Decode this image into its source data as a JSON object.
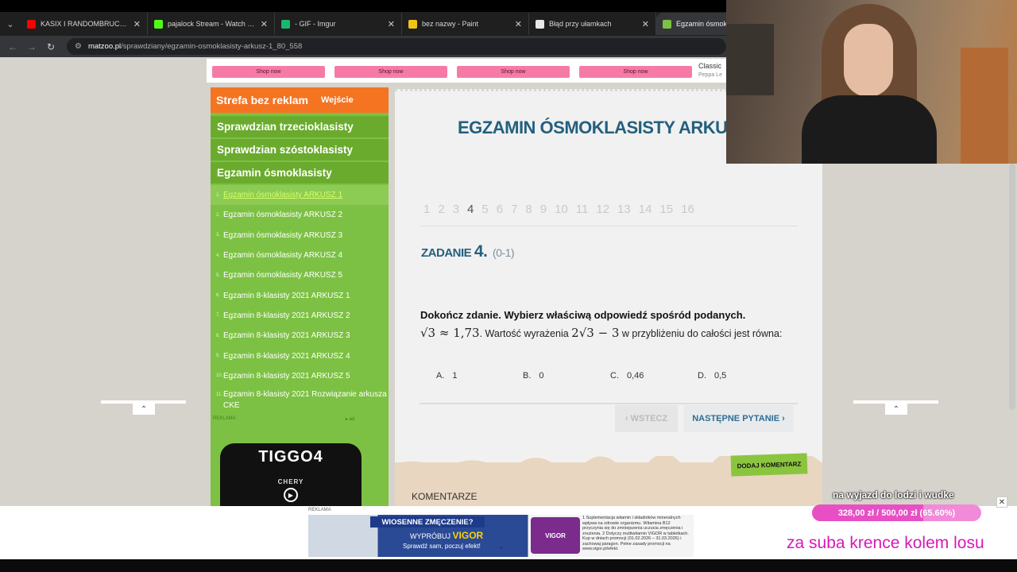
{
  "browser": {
    "tabs": [
      {
        "title": "KASIX I RANDOMBRUCE WYJAŚ",
        "color": "#ff0000"
      },
      {
        "title": "pajalock Stream - Watch Live o",
        "color": "#53fc18"
      },
      {
        "title": "- GIF - Imgur",
        "color": "#1bb76e"
      },
      {
        "title": "bez nazwy - Paint",
        "color": "#f0c419"
      },
      {
        "title": "Błąd przy ułamkach",
        "color": "#e8e8e8"
      },
      {
        "title": "Egzamin ósmoklasi",
        "color": "#7cc143"
      }
    ],
    "url_host": "matzoo.pl",
    "url_path": "/sprawdziany/egzamin-osmoklasisty-arkusz-1_80_558"
  },
  "topad": {
    "shop_label": "Shop now",
    "classic": "Classic",
    "peppa": "Peppa Le"
  },
  "sidebar": {
    "header_title": "Strefa bez reklam",
    "header_login": "Wejście",
    "categories": [
      "Sprawdzian trzecioklasisty",
      "Sprawdzian szóstoklasisty",
      "Egzamin ósmoklasisty"
    ],
    "items": [
      {
        "n": "1.",
        "label": "Egzamin ósmoklasisty ARKUSZ 1"
      },
      {
        "n": "2.",
        "label": "Egzamin ósmoklasisty ARKUSZ 2"
      },
      {
        "n": "3.",
        "label": "Egzamin ósmoklasisty ARKUSZ 3"
      },
      {
        "n": "4.",
        "label": "Egzamin ósmoklasisty ARKUSZ 4"
      },
      {
        "n": "5.",
        "label": "Egzamin ósmoklasisty ARKUSZ 5"
      },
      {
        "n": "6.",
        "label": "Egzamin 8-klasisty 2021 ARKUSZ 1"
      },
      {
        "n": "7.",
        "label": "Egzamin 8-klasisty 2021 ARKUSZ 2"
      },
      {
        "n": "8.",
        "label": "Egzamin 8-klasisty 2021 ARKUSZ 3"
      },
      {
        "n": "9.",
        "label": "Egzamin 8-klasisty 2021 ARKUSZ 4"
      },
      {
        "n": "10.",
        "label": "Egzamin 8-klasisty 2021 ARKUSZ 5"
      },
      {
        "n": "11.",
        "label": "Egzamin 8-klasisty 2021 Rozwiązanie arkusza CKE"
      }
    ],
    "reklama": "REKLAMA",
    "ad_brand": "TIGGO4",
    "ad_maker": "CHERY"
  },
  "main": {
    "title": "EGZAMIN ÓSMOKLASISTY ARKUSZ",
    "pager": [
      "1",
      "2",
      "3",
      "4",
      "5",
      "6",
      "7",
      "8",
      "9",
      "10",
      "11",
      "12",
      "13",
      "14",
      "15",
      "16"
    ],
    "current_page": "4",
    "task_label": "ZADANIE",
    "task_num": "4.",
    "task_points": "(0-1)",
    "instruction": "Dokończ zdanie. Wybierz właściwą odpowiedź spośród podanych.",
    "q_math1": "√3 ≈ 1,73",
    "q_text1": ". Wartość wyrażenia ",
    "q_math2": "2√3 − 3",
    "q_text2": " w przybliżeniu do całości jest równa:",
    "answers": [
      {
        "letter": "A.",
        "value": "1"
      },
      {
        "letter": "B.",
        "value": "0"
      },
      {
        "letter": "C.",
        "value": "0,46"
      },
      {
        "letter": "D.",
        "value": "0,5"
      }
    ],
    "back_label": "‹ WSTECZ",
    "next_label": "NASTĘPNE PYTANIE ›",
    "comment_btn": "DODAJ KOMENTARZ",
    "comments_title": "KOMENTARZE"
  },
  "bottom_ad": {
    "reklama": "REKLAMA",
    "headline": "WIOSENNE ZMĘCZENIE?",
    "try_prefix": "WYPRÓBUJ",
    "brand": "VIGOR",
    "sub": "Sprawdź sam, poczuj efekt!",
    "pack": "VIGOR",
    "small_text": "1 Suplementacja witamin i składników mineralnych wpływa na zdrowie organizmu. Witamina B12 przyczynia się do zmniejszenia uczucia zmęczenia i znużenia. 2 Dotyczy multiwitamin VIGOR w tabletkach. Kup w dniach promocji (01.02.2026 – 31.03.2026) i zachowaj paragon. Pełne zasady promocji na www.vigor.pl/efekt."
  },
  "overlay": {
    "goal_title": "na wyjazd do lodzi i wudke",
    "goal_value": "328,00 zł / 500,00 zł (65.60%)",
    "goal_fraction": 0.656,
    "sub_text": "za suba krence kolem losu"
  }
}
